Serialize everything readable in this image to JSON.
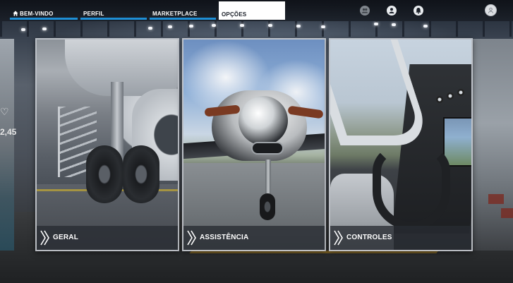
{
  "topnav": {
    "tabs": [
      {
        "label": "BEM-VINDO",
        "icon": "home-icon"
      },
      {
        "label": "PERFIL"
      },
      {
        "label": "MARKETPLACE"
      },
      {
        "label": "OPÇÕES"
      }
    ],
    "active_tab": "OPÇÕES",
    "right_icons": [
      "group-icon",
      "profile-icon",
      "notifications-icon",
      "avatar"
    ],
    "accent_color": "#1e8fd6"
  },
  "cards": [
    {
      "label": "GERAL",
      "scene": "landing gear in hangar"
    },
    {
      "label": "ASSISTÊNCIA",
      "scene": "propeller aircraft nose"
    },
    {
      "label": "CONTROLES",
      "scene": "cockpit interior"
    }
  ],
  "side_peek": {
    "left_price": "2,45",
    "left_icon": "heart-icon"
  }
}
